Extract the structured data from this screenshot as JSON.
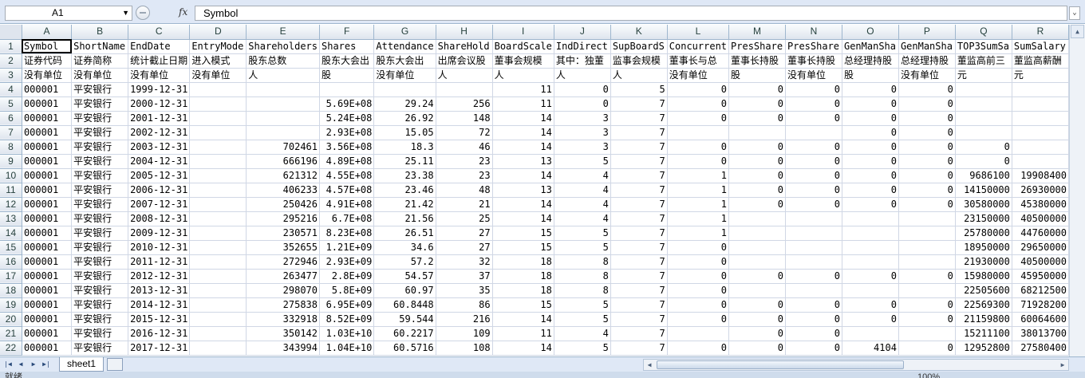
{
  "formula_bar": {
    "name_box": "A1",
    "fx_label": "fx",
    "content": "Symbol"
  },
  "columns": [
    "A",
    "B",
    "C",
    "D",
    "E",
    "F",
    "G",
    "H",
    "I",
    "J",
    "K",
    "L",
    "M",
    "N",
    "O",
    "P",
    "Q",
    "R"
  ],
  "rows": [
    [
      "Symbol",
      "ShortName",
      "EndDate",
      "EntryMode",
      "Shareholders",
      "Shares",
      "Attendance",
      "ShareHold",
      "BoardScale",
      "IndDirect",
      "SupBoardS",
      "Concurrent",
      "PresShare",
      "PresShare",
      "GenManSha",
      "GenManSha",
      "TOP3SumSa",
      "SumSalary"
    ],
    [
      "证券代码",
      "证券简称",
      "统计截止日期",
      "进入模式",
      "股东总数",
      "股东大会出",
      "股东大会出",
      "出席会议股",
      "董事会规模",
      "其中：独董",
      "监事会规模",
      "董事长与总",
      "董事长持股",
      "董事长持股",
      "总经理持股",
      "总经理持股",
      "董监高前三",
      "董监高薪酬"
    ],
    [
      "没有单位",
      "没有单位",
      "没有单位",
      "没有单位",
      "人",
      "股",
      "没有单位",
      "人",
      "人",
      "人",
      "人",
      "没有单位",
      "股",
      "没有单位",
      "股",
      "没有单位",
      "元",
      "元"
    ],
    [
      "000001",
      "平安银行",
      "1999-12-31",
      "",
      "",
      "",
      "",
      "",
      "11",
      "0",
      "5",
      "0",
      "0",
      "0",
      "0",
      "0",
      "",
      ""
    ],
    [
      "000001",
      "平安银行",
      "2000-12-31",
      "",
      "",
      "5.69E+08",
      "29.24",
      "256",
      "11",
      "0",
      "7",
      "0",
      "0",
      "0",
      "0",
      "0",
      "",
      ""
    ],
    [
      "000001",
      "平安银行",
      "2001-12-31",
      "",
      "",
      "5.24E+08",
      "26.92",
      "148",
      "14",
      "3",
      "7",
      "0",
      "0",
      "0",
      "0",
      "0",
      "",
      ""
    ],
    [
      "000001",
      "平安银行",
      "2002-12-31",
      "",
      "",
      "2.93E+08",
      "15.05",
      "72",
      "14",
      "3",
      "7",
      "",
      "",
      "",
      "0",
      "0",
      "",
      ""
    ],
    [
      "000001",
      "平安银行",
      "2003-12-31",
      "",
      "702461",
      "3.56E+08",
      "18.3",
      "46",
      "14",
      "3",
      "7",
      "0",
      "0",
      "0",
      "0",
      "0",
      "0",
      ""
    ],
    [
      "000001",
      "平安银行",
      "2004-12-31",
      "",
      "666196",
      "4.89E+08",
      "25.11",
      "23",
      "13",
      "5",
      "7",
      "0",
      "0",
      "0",
      "0",
      "0",
      "0",
      ""
    ],
    [
      "000001",
      "平安银行",
      "2005-12-31",
      "",
      "621312",
      "4.55E+08",
      "23.38",
      "23",
      "14",
      "4",
      "7",
      "1",
      "0",
      "0",
      "0",
      "0",
      "9686100",
      "19908400"
    ],
    [
      "000001",
      "平安银行",
      "2006-12-31",
      "",
      "406233",
      "4.57E+08",
      "23.46",
      "48",
      "13",
      "4",
      "7",
      "1",
      "0",
      "0",
      "0",
      "0",
      "14150000",
      "26930000"
    ],
    [
      "000001",
      "平安银行",
      "2007-12-31",
      "",
      "250426",
      "4.91E+08",
      "21.42",
      "21",
      "14",
      "4",
      "7",
      "1",
      "0",
      "0",
      "0",
      "0",
      "30580000",
      "45380000"
    ],
    [
      "000001",
      "平安银行",
      "2008-12-31",
      "",
      "295216",
      "6.7E+08",
      "21.56",
      "25",
      "14",
      "4",
      "7",
      "1",
      "",
      "",
      "",
      "",
      "23150000",
      "40500000"
    ],
    [
      "000001",
      "平安银行",
      "2009-12-31",
      "",
      "230571",
      "8.23E+08",
      "26.51",
      "27",
      "15",
      "5",
      "7",
      "1",
      "",
      "",
      "",
      "",
      "25780000",
      "44760000"
    ],
    [
      "000001",
      "平安银行",
      "2010-12-31",
      "",
      "352655",
      "1.21E+09",
      "34.6",
      "27",
      "15",
      "5",
      "7",
      "0",
      "",
      "",
      "",
      "",
      "18950000",
      "29650000"
    ],
    [
      "000001",
      "平安银行",
      "2011-12-31",
      "",
      "272946",
      "2.93E+09",
      "57.2",
      "32",
      "18",
      "8",
      "7",
      "0",
      "",
      "",
      "",
      "",
      "21930000",
      "40500000"
    ],
    [
      "000001",
      "平安银行",
      "2012-12-31",
      "",
      "263477",
      "2.8E+09",
      "54.57",
      "37",
      "18",
      "8",
      "7",
      "0",
      "0",
      "0",
      "0",
      "0",
      "15980000",
      "45950000"
    ],
    [
      "000001",
      "平安银行",
      "2013-12-31",
      "",
      "298070",
      "5.8E+09",
      "60.97",
      "35",
      "18",
      "8",
      "7",
      "0",
      "",
      "",
      "",
      "",
      "22505600",
      "68212500"
    ],
    [
      "000001",
      "平安银行",
      "2014-12-31",
      "",
      "275838",
      "6.95E+09",
      "60.8448",
      "86",
      "15",
      "5",
      "7",
      "0",
      "0",
      "0",
      "0",
      "0",
      "22569300",
      "71928200"
    ],
    [
      "000001",
      "平安银行",
      "2015-12-31",
      "",
      "332918",
      "8.52E+09",
      "59.544",
      "216",
      "14",
      "5",
      "7",
      "0",
      "0",
      "0",
      "0",
      "0",
      "21159800",
      "60064600"
    ],
    [
      "000001",
      "平安银行",
      "2016-12-31",
      "",
      "350142",
      "1.03E+10",
      "60.2217",
      "109",
      "11",
      "4",
      "7",
      "",
      "0",
      "0",
      "",
      "",
      "15211100",
      "38013700"
    ],
    [
      "000001",
      "平安银行",
      "2017-12-31",
      "",
      "343994",
      "1.04E+10",
      "60.5716",
      "108",
      "14",
      "5",
      "7",
      "0",
      "0",
      "0",
      "4104",
      "0",
      "12952800",
      "27580400"
    ]
  ],
  "sheet_tab": "sheet1",
  "status": {
    "left": "就绪",
    "zoom": "100%"
  }
}
